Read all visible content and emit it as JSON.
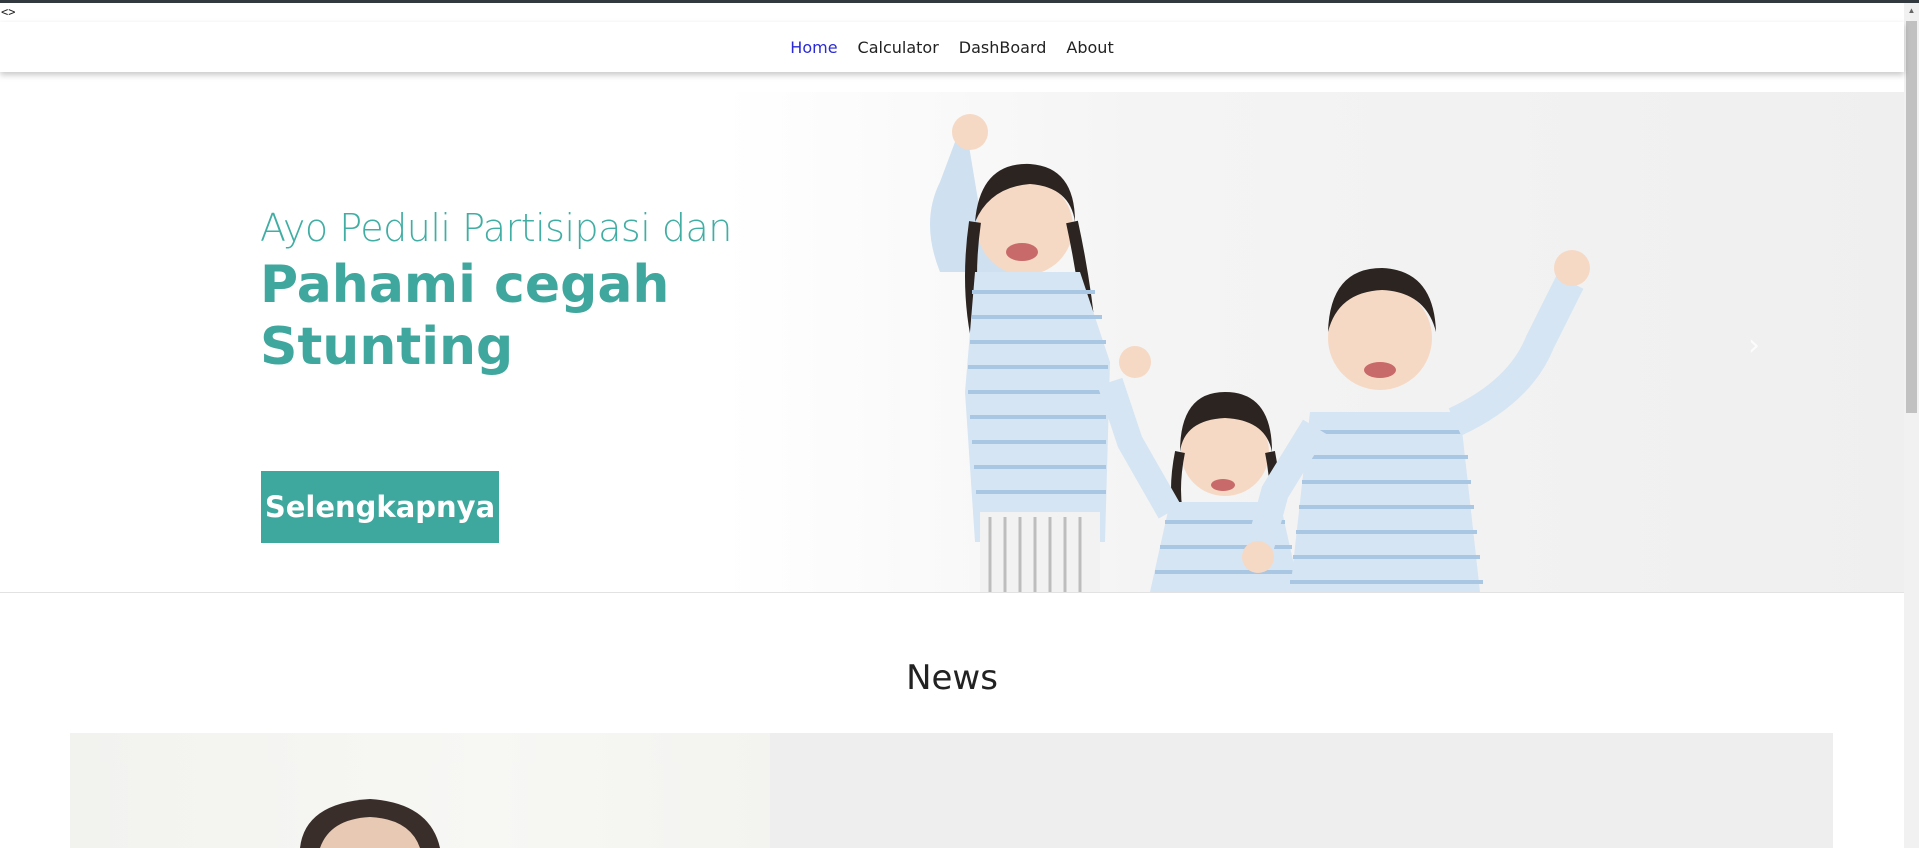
{
  "devtools": {
    "marker": "<>"
  },
  "nav": {
    "items": [
      {
        "label": "Home",
        "active": true
      },
      {
        "label": "Calculator",
        "active": false
      },
      {
        "label": "DashBoard",
        "active": false
      },
      {
        "label": "About",
        "active": false
      }
    ]
  },
  "hero": {
    "line1": "Ayo Peduli Partisipasi dan",
    "line2": "Pahami cegah Stunting",
    "button_label": "Selengkapnya",
    "next_glyph": "›",
    "accent_color": "#3fa89e"
  },
  "news": {
    "title": "News"
  }
}
